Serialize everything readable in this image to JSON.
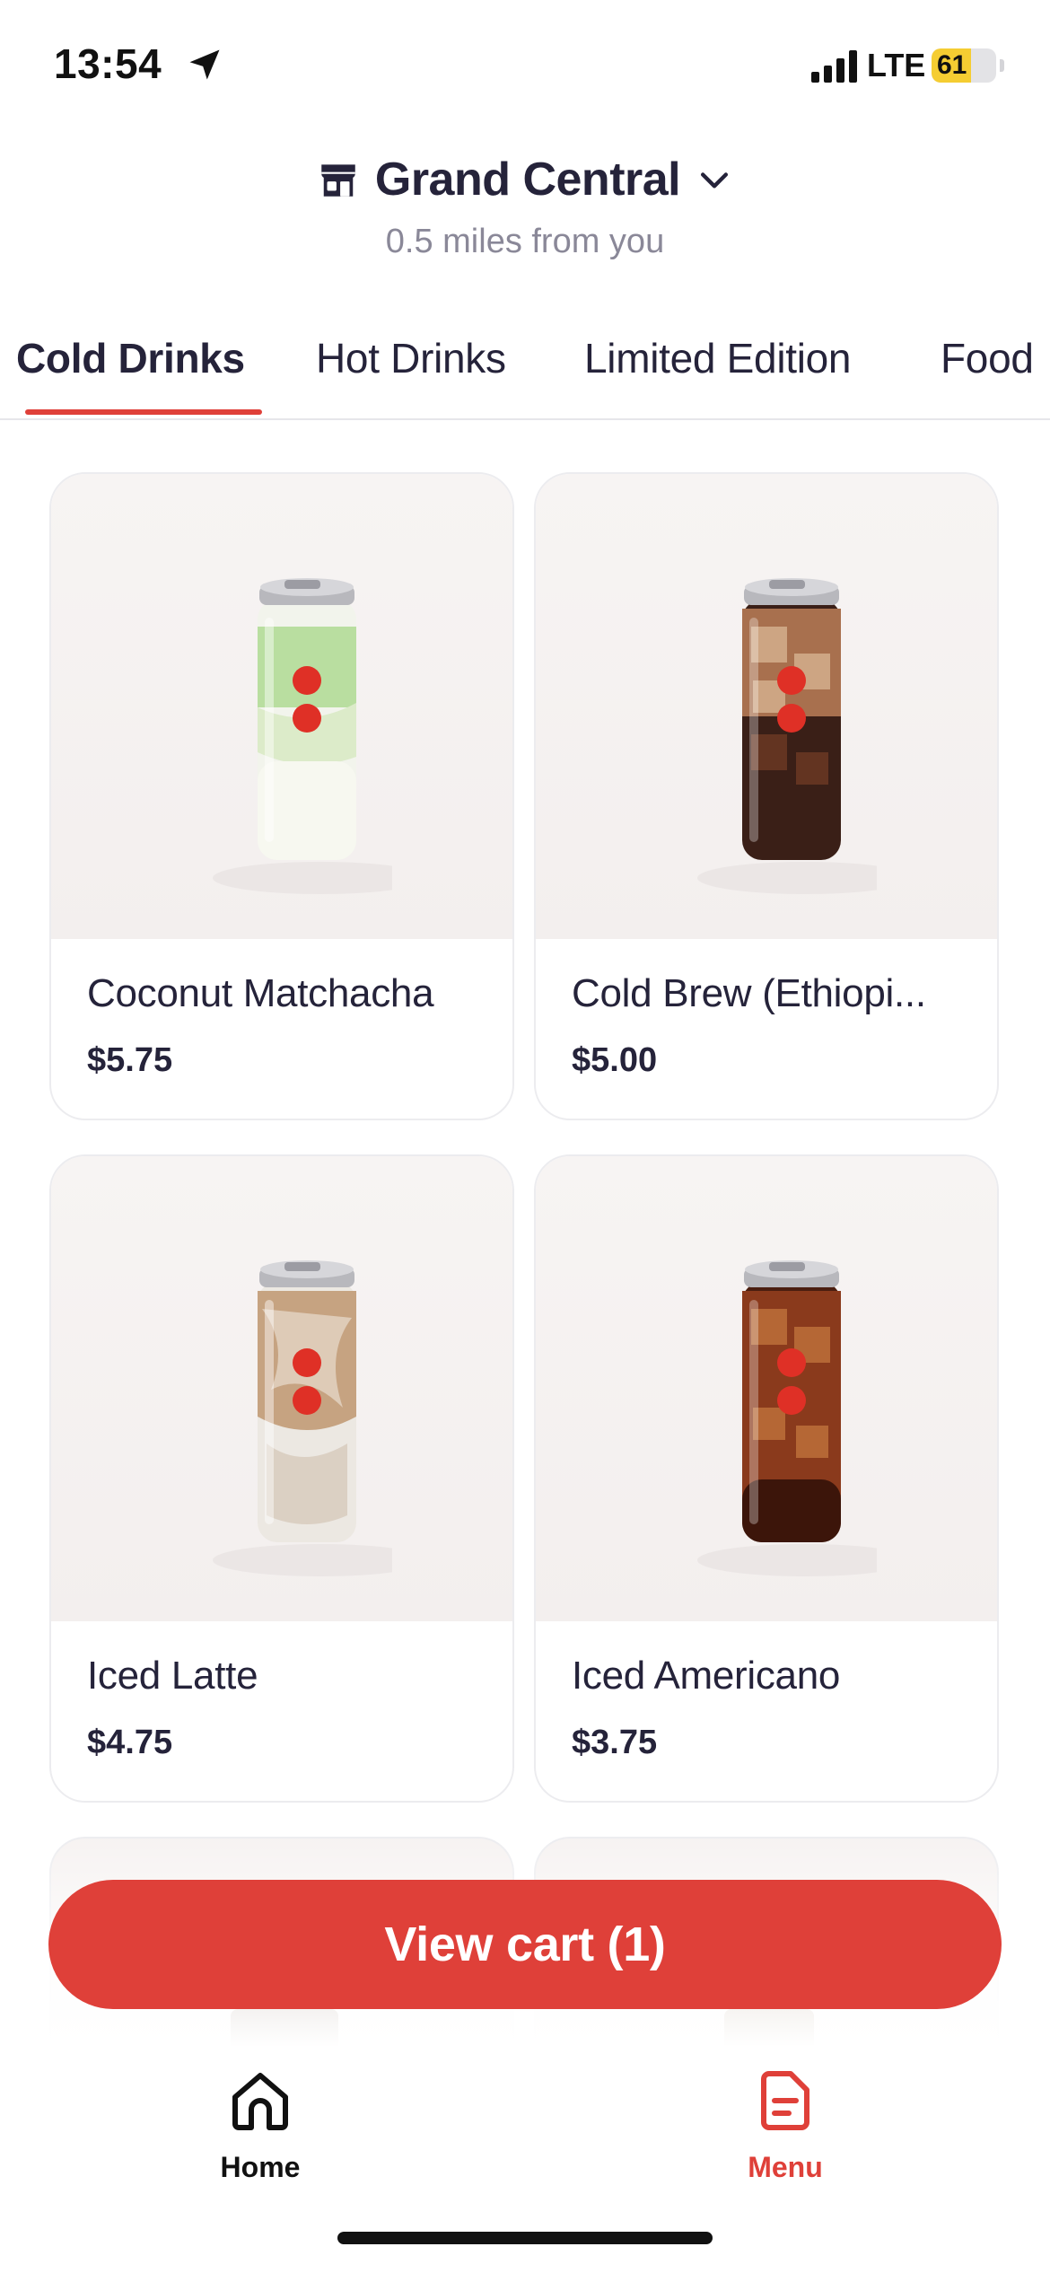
{
  "status_bar": {
    "time": "13:54",
    "network": "LTE",
    "battery_level": "61",
    "battery_fraction": 0.61,
    "icons": [
      "location-arrow-icon",
      "cellular-signal-icon",
      "battery-icon"
    ]
  },
  "header": {
    "store_name": "Grand Central",
    "distance": "0.5 miles from you",
    "icons": [
      "store-icon",
      "chevron-down-icon"
    ]
  },
  "tabs": [
    {
      "label": "Cold Drinks",
      "active": true
    },
    {
      "label": "Hot Drinks",
      "active": false
    },
    {
      "label": "Limited Edition",
      "active": false
    },
    {
      "label": "Food",
      "active": false
    }
  ],
  "products": [
    {
      "name": "Coconut Matchacha",
      "price": "$5.75",
      "drink": "matcha"
    },
    {
      "name": "Cold Brew (Ethiopi...",
      "price": "$5.00",
      "drink": "cold-brew"
    },
    {
      "name": "Iced Latte",
      "price": "$4.75",
      "drink": "latte"
    },
    {
      "name": "Iced Americano",
      "price": "$3.75",
      "drink": "americano"
    }
  ],
  "cart": {
    "label": "View cart (1)"
  },
  "bottom_nav": {
    "home_label": "Home",
    "menu_label": "Menu"
  },
  "colors": {
    "accent": "#df4039",
    "text_primary": "#25233a",
    "text_secondary": "#8a8898",
    "battery": "#f5cd32"
  }
}
